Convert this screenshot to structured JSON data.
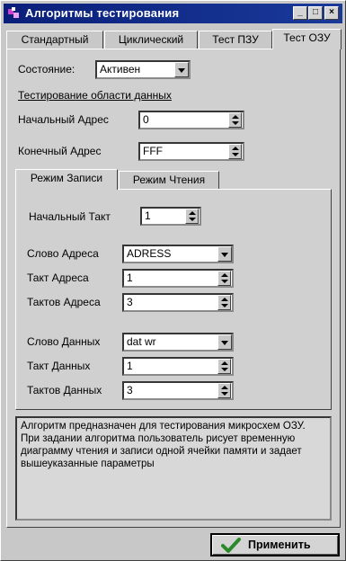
{
  "window": {
    "title": "Алгоритмы тестирования",
    "controls": {
      "minimize": "_",
      "maximize": "□",
      "close": "×"
    }
  },
  "tabs": [
    "Стандартный",
    "Циклический",
    "Тест ПЗУ",
    "Тест ОЗУ"
  ],
  "active_tab": "Тест ОЗУ",
  "state": {
    "label": "Состояние:",
    "value": "Активен"
  },
  "data_region": {
    "heading": "Тестирование области данных",
    "start_address_label": "Начальный Адрес",
    "start_address_value": "0",
    "end_address_label": "Конечный Адрес",
    "end_address_value": "FFF"
  },
  "subtabs": [
    "Режим Записи",
    "Режим Чтения"
  ],
  "active_subtab": "Режим Записи",
  "write_mode": {
    "start_tact_label": "Начальный Такт",
    "start_tact_value": "1",
    "addr_word_label": "Слово Адреса",
    "addr_word_value": "ADRESS",
    "addr_tact_label": "Такт Адреса",
    "addr_tact_value": "1",
    "addr_tacts_label": "Тактов Адреса",
    "addr_tacts_value": "3",
    "data_word_label": "Слово Данных",
    "data_word_value": "dat wr",
    "data_tact_label": "Такт Данных",
    "data_tact_value": "1",
    "data_tacts_label": "Тактов Данных",
    "data_tacts_value": "3"
  },
  "description": "Алгоритм предназначен для тестирования микросхем ОЗУ. При задании алгоритма пользователь рисует временную диаграмму чтения и записи одной ячейки памяти и задает вышеуказанные параметры",
  "apply_button": "Применить",
  "icons": {
    "app": "app-icon",
    "apply": "checkmark-icon"
  },
  "colors": {
    "titlebar": "#0a1f7a",
    "face": "#c8c8c8",
    "check": "#2a8a2a"
  }
}
